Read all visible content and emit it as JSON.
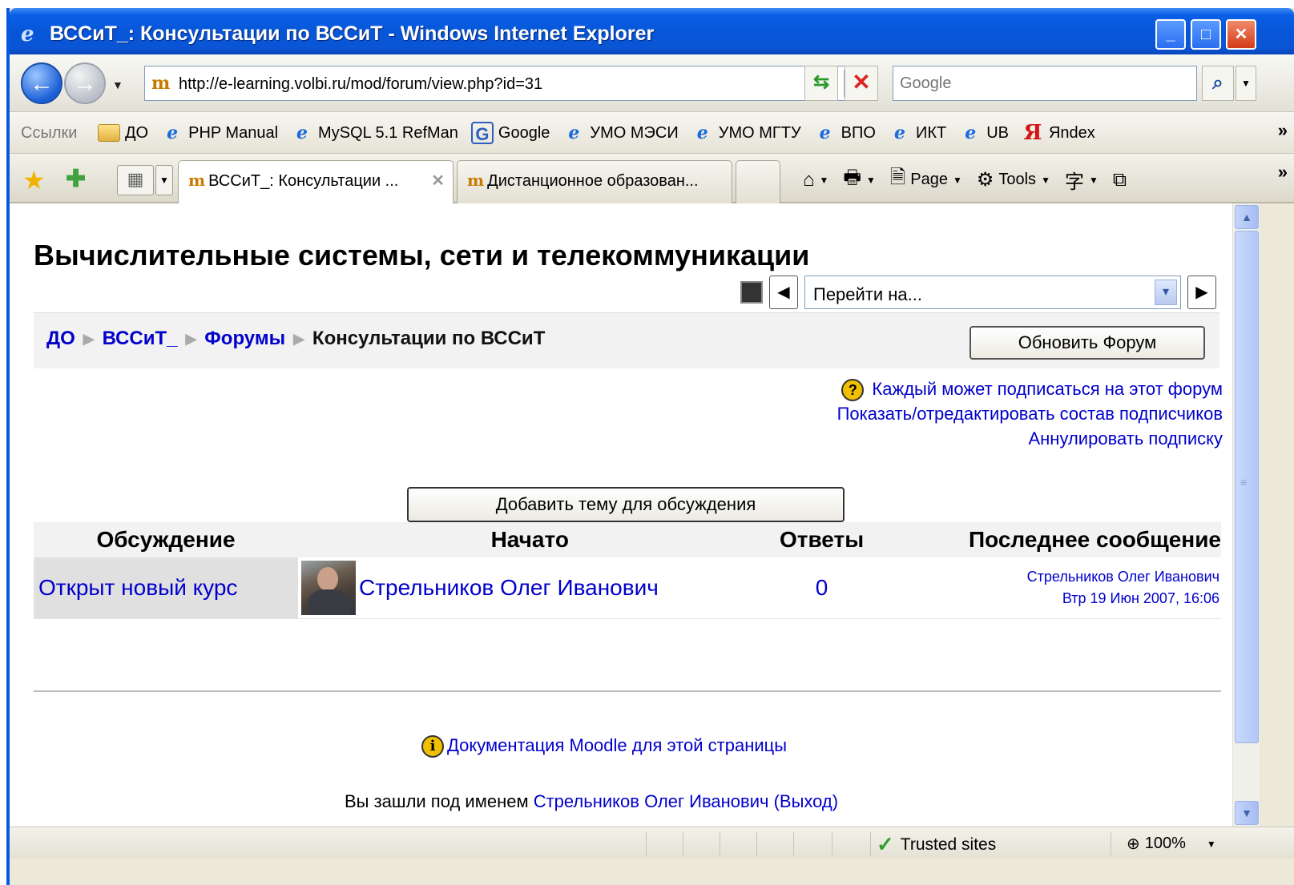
{
  "window": {
    "title": "ВССиТ_: Консультации по ВССиТ - Windows Internet Explorer",
    "min_label": "_",
    "max_label": "□",
    "close_label": "✕"
  },
  "address": {
    "url": "http://e-learning.volbi.ru/mod/forum/view.php?id=31",
    "search_placeholder": "Google"
  },
  "links": {
    "label": "Ссылки",
    "items": [
      {
        "label": "ДО",
        "icon": "folder-icon"
      },
      {
        "label": "PHP Manual",
        "icon": "ie-page-icon"
      },
      {
        "label": "MySQL 5.1 RefMan",
        "icon": "ie-page-icon"
      },
      {
        "label": "Google",
        "icon": "google-icon"
      },
      {
        "label": "УМО МЭСИ",
        "icon": "ie-page-icon"
      },
      {
        "label": "УМО МГТУ",
        "icon": "ie-page-icon"
      },
      {
        "label": "ВПО",
        "icon": "ie-page-icon"
      },
      {
        "label": "ИКТ",
        "icon": "ie-page-icon"
      },
      {
        "label": "UB",
        "icon": "ie-page-icon"
      },
      {
        "label": "Яndex",
        "icon": "yandex-icon"
      }
    ]
  },
  "tabs": [
    {
      "label": "ВССиТ_: Консультации ...",
      "active": true
    },
    {
      "label": "Дистанционное образован...",
      "active": false
    }
  ],
  "commands": {
    "page": "Page",
    "tools": "Tools"
  },
  "page": {
    "course_title": "Вычислительные системы, сети и телекоммуникации",
    "jump_label": "Перейти на...",
    "breadcrumb": {
      "home": "ДО",
      "course": "ВССиТ_",
      "forums": "Форумы",
      "current": "Консультации по ВССиТ"
    },
    "update_button": "Обновить Форум",
    "subscribe_info": "Каждый может подписаться на этот форум",
    "show_subscribers": "Показать/отредактировать состав подписчиков",
    "unsubscribe": "Аннулировать подписку",
    "add_topic_button": "Добавить тему для обсуждения",
    "table": {
      "headers": [
        "Обсуждение",
        "Начато",
        "Ответы",
        "Последнее сообщение"
      ],
      "rows": [
        {
          "topic": "Открыт новый курс",
          "starter": "Стрельников Олег Иванович",
          "replies": "0",
          "last_author": "Стрельников Олег Иванович",
          "last_date": "Втр 19 Июн 2007, 16:06"
        }
      ]
    },
    "doc_link": "Документация Moodle для этой страницы",
    "login_prefix": "Вы зашли под именем",
    "login_user": "Стрельников Олег Иванович",
    "logout": "(Выход)"
  },
  "status": {
    "zone": "Trusted sites",
    "zoom": "100%"
  }
}
